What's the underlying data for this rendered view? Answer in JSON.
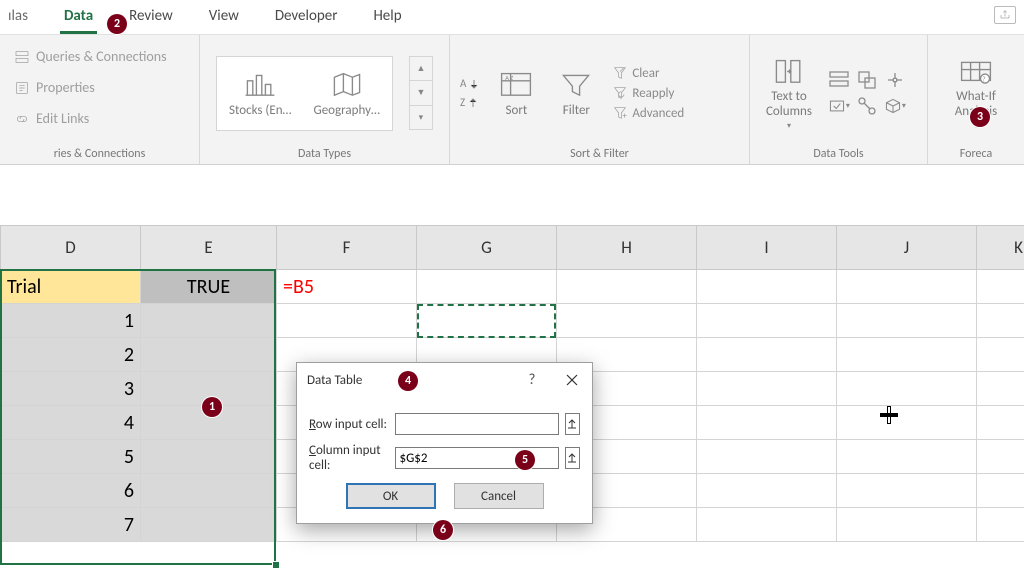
{
  "tabs": {
    "cut": "ılas",
    "data": "Data",
    "review": "Review",
    "view": "View",
    "developer": "Developer",
    "help": "Help"
  },
  "ribbon": {
    "queries_connections": "Queries & Connections",
    "properties": "Properties",
    "edit_links": "Edit Links",
    "group_queries": "ries & Connections",
    "stocks": "Stocks (En…",
    "geography": "Geography…",
    "group_datatypes": "Data Types",
    "sort": "Sort",
    "filter": "Filter",
    "clear": "Clear",
    "reapply": "Reapply",
    "advanced": "Advanced",
    "group_sortfilter": "Sort & Filter",
    "text_to_columns": "Text to\nColumns",
    "group_datatools": "Data Tools",
    "whatif": "What-If\nAnalysis",
    "group_forecast": "Foreca"
  },
  "columns": [
    "D",
    "E",
    "F",
    "G",
    "H",
    "I",
    "J",
    "K"
  ],
  "trial_header": "Trial",
  "true_header": "TRUE",
  "trial_values": [
    "1",
    "2",
    "3",
    "4",
    "5",
    "6",
    "7"
  ],
  "formula_display": "=B5",
  "dialog": {
    "title": "Data Table",
    "row_label": "Row input cell:",
    "col_label": "Column input cell:",
    "row_value": "",
    "col_value": "$G$2",
    "ok": "OK",
    "cancel": "Cancel"
  },
  "badges": [
    "1",
    "2",
    "3",
    "4",
    "5",
    "6"
  ]
}
